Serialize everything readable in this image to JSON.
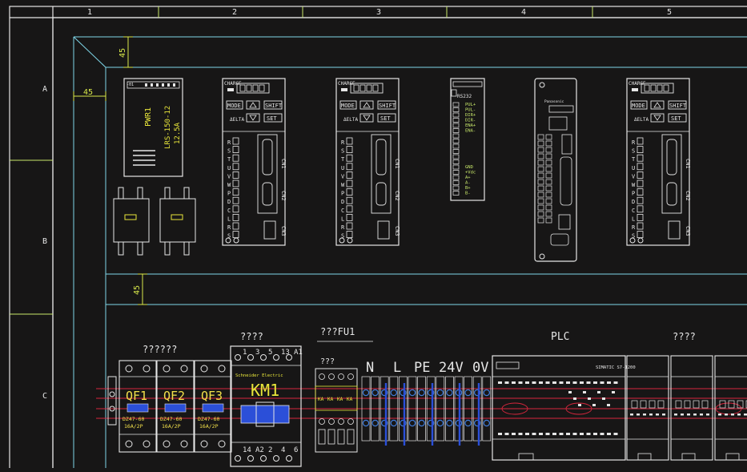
{
  "colors": {
    "background": "#171616",
    "frame": "#e6e6e6",
    "grid": "#c8e86a",
    "dimension": "#d8e84a",
    "cyan": "#7fd6e8",
    "label_yellow": "#e8e63a",
    "breaker_yellow": "#f1e04a",
    "blue_block": "#2b4fd8",
    "rail_red": "#d7263d",
    "terminal_blue": "#3f7ad6"
  },
  "grid": {
    "columns": [
      "1",
      "2",
      "3",
      "4",
      "5"
    ],
    "rows": [
      "A",
      "B",
      "C"
    ]
  },
  "dimensions": [
    "45",
    "45",
    "45"
  ],
  "power_supply": {
    "tag": "PWR1",
    "model": "LRS-150-12",
    "rating": "12.5A",
    "corner_label": "-01"
  },
  "servo_drives": [
    {
      "charge": "CHARGE",
      "keys": [
        "MODE",
        "SHIFT",
        "SET"
      ],
      "brand": "ΔELTA",
      "ports": [
        "CN1",
        "CN2",
        "CN3"
      ],
      "terminals": [
        "R",
        "S",
        "T",
        "U",
        "V",
        "W",
        "P",
        "D",
        "C",
        "L",
        "R",
        "S"
      ]
    },
    {
      "charge": "CHARGE",
      "keys": [
        "MODE",
        "SHIFT",
        "SET"
      ],
      "brand": "ΔELTA",
      "ports": [
        "CN1",
        "CN2",
        "CN3"
      ],
      "terminals": [
        "R",
        "S",
        "T",
        "U",
        "V",
        "W",
        "P",
        "D",
        "C",
        "L",
        "R",
        "S"
      ]
    },
    {
      "charge": "CHARGE",
      "keys": [
        "MODE",
        "SHIFT",
        "SET"
      ],
      "brand": "ΔELTA",
      "ports": [
        "CN1",
        "CN2",
        "CN3"
      ],
      "terminals": [
        "R",
        "S",
        "T",
        "U",
        "V",
        "W",
        "P",
        "D",
        "C",
        "L",
        "R",
        "S"
      ]
    }
  ],
  "stepper_driver": {
    "top": "RS232",
    "signals": [
      "PUL+",
      "PUL-",
      "DIR+",
      "DIR-",
      "ENA+",
      "ENA-"
    ],
    "power": [
      "GND",
      "+Vdc",
      "A+",
      "A-",
      "B+",
      "B-"
    ]
  },
  "plc_module": {
    "brand": "Panasonic"
  },
  "breakers": {
    "group_label": "??????",
    "items": [
      {
        "tag": "QF1",
        "model": "DZ47-60",
        "rating": "16A/2P"
      },
      {
        "tag": "QF2",
        "model": "DZ47-60",
        "rating": "16A/2P"
      },
      {
        "tag": "QF3",
        "model": "DZ47-60",
        "rating": "16A/2P"
      }
    ]
  },
  "contactor": {
    "group_label": "????",
    "tag": "KM1",
    "brand": "Schneider Electric",
    "top_terminals": [
      "1",
      "3",
      "5",
      "13",
      "A1"
    ],
    "bottom_terminals": [
      "14",
      "A2",
      "2",
      "4",
      "6"
    ]
  },
  "fuse": {
    "label": "???FU1",
    "group_label": "???",
    "blocks": [
      "KA",
      "KA",
      "KA",
      "KA"
    ]
  },
  "terminal_labels": [
    "N",
    "L",
    "PE",
    "24V",
    "0V"
  ],
  "plc": {
    "label": "PLC",
    "model_text": "SIMATIC S7-1200",
    "module_group_label": "????"
  }
}
